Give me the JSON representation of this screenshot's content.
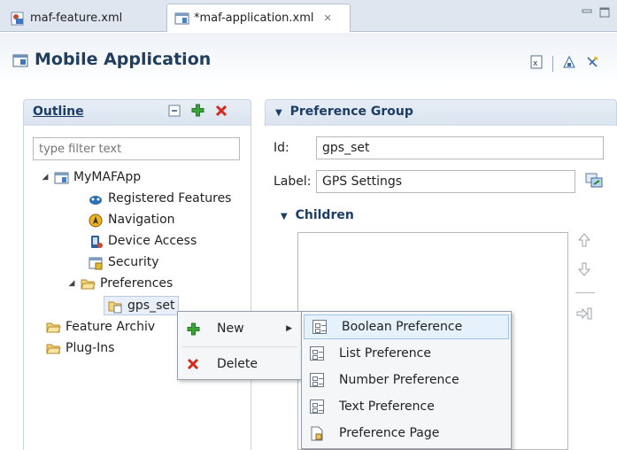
{
  "tabs": [
    {
      "label": "maf-feature.xml",
      "icon": "xml-feature-file-icon",
      "active": false
    },
    {
      "label": "*maf-application.xml",
      "icon": "application-file-icon",
      "active": true,
      "close": "✕"
    }
  ],
  "editor": {
    "title": "Mobile Application"
  },
  "outline": {
    "title": "Outline",
    "filter_placeholder": "type filter text",
    "tree": {
      "root": "MyMAFApp",
      "registered_features": "Registered Features",
      "navigation": "Navigation",
      "device_access": "Device Access",
      "security": "Security",
      "preferences": "Preferences",
      "gps_set": "gps_set",
      "feature_archives": "Feature Archiv",
      "plug_ins": "Plug-Ins"
    }
  },
  "preference_group": {
    "title": "Preference Group",
    "id_label": "Id:",
    "id_value": "gps_set",
    "label_label": "Label:",
    "label_value": "GPS Settings",
    "children_label": "Children"
  },
  "context_menu": {
    "new_label": "New",
    "delete_label": "Delete"
  },
  "submenu": {
    "items": [
      "Boolean Preference",
      "List Preference",
      "Number Preference",
      "Text Preference",
      "Preference Page"
    ]
  },
  "colors": {
    "section_title": "#1c3d66",
    "highlight": "#e5f1fb",
    "delete_red": "#d9281e",
    "add_green": "#3ca43c"
  }
}
